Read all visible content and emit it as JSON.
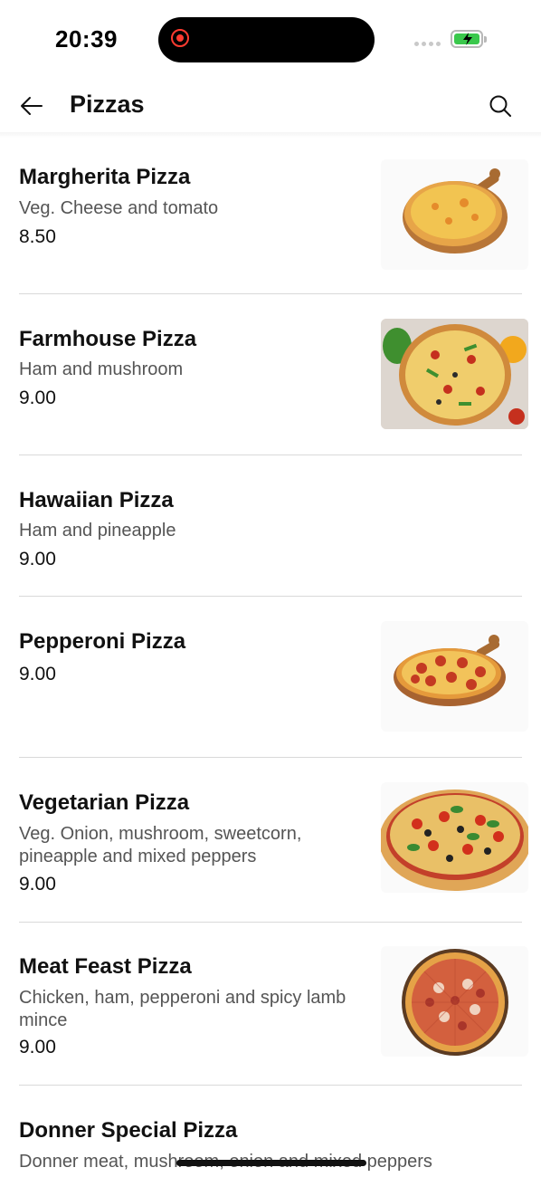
{
  "status": {
    "time": "20:39"
  },
  "header": {
    "title": "Pizzas"
  },
  "items": [
    {
      "name": "Margherita Pizza",
      "desc": "Veg. Cheese and tomato",
      "price": "8.50"
    },
    {
      "name": "Farmhouse Pizza",
      "desc": "Ham and mushroom",
      "price": "9.00"
    },
    {
      "name": "Hawaiian Pizza",
      "desc": "Ham and pineapple",
      "price": "9.00"
    },
    {
      "name": "Pepperoni Pizza",
      "price": "9.00"
    },
    {
      "name": "Vegetarian Pizza",
      "desc": "Veg. Onion, mushroom, sweetcorn, pineapple and mixed peppers",
      "price": "9.00"
    },
    {
      "name": "Meat Feast Pizza",
      "desc": "Chicken, ham, pepperoni and spicy lamb mince",
      "price": "9.00"
    },
    {
      "name": "Donner Special Pizza",
      "desc": "Donner meat, mushroom, onion and mixed peppers"
    }
  ],
  "icons": {
    "back": "arrow-left-icon",
    "search": "search-icon",
    "record": "record-icon",
    "battery": "battery-charging-icon"
  },
  "colors": {
    "battery": "#3ac84c",
    "record": "#ff3b30"
  }
}
